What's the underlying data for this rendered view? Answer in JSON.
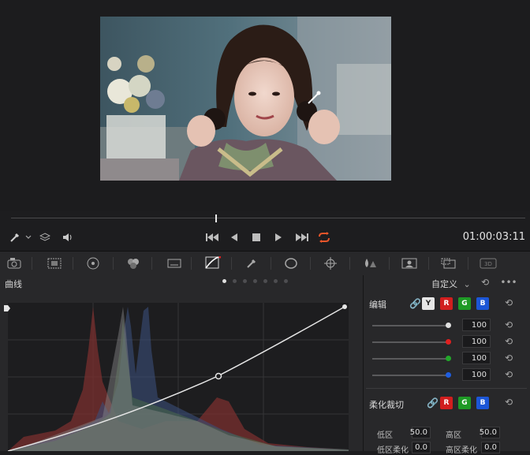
{
  "transport": {
    "timecode": "01:00:03:11"
  },
  "curves": {
    "title": "曲线",
    "preset": "自定义",
    "page_dots": 7,
    "active_dot": 0
  },
  "edit": {
    "label": "编辑",
    "channels": [
      "Y",
      "R",
      "G",
      "B"
    ],
    "rows": [
      {
        "channel": "Y",
        "value": "100",
        "color": "#e0e0e0"
      },
      {
        "channel": "R",
        "value": "100",
        "color": "#e02020"
      },
      {
        "channel": "G",
        "value": "100",
        "color": "#22a82a"
      },
      {
        "channel": "B",
        "value": "100",
        "color": "#1f5ee0"
      }
    ]
  },
  "soft_clip": {
    "label": "柔化裁切",
    "channels": [
      "R",
      "G",
      "B"
    ],
    "low_label": "低区",
    "low_value": "50.0",
    "high_label": "高区",
    "high_value": "50.0",
    "low_soft_label": "低区柔化",
    "low_soft_value": "0.0",
    "high_soft_label": "高区柔化",
    "high_soft_value": "0.0"
  },
  "colors": {
    "accent_red": "#e02020",
    "accent_green": "#22a82a",
    "accent_blue": "#1f5ee0",
    "loop_active": "#e8552a"
  },
  "icons": {
    "palette": [
      "camera-raw-icon",
      "color-match-icon",
      "color-wheels-icon",
      "rgb-mixer-icon",
      "motion-effects-icon",
      "curves-icon",
      "qualifier-icon",
      "window-icon",
      "tracker-icon",
      "blur-icon",
      "key-icon",
      "sizing-icon",
      "3d-icon"
    ]
  }
}
